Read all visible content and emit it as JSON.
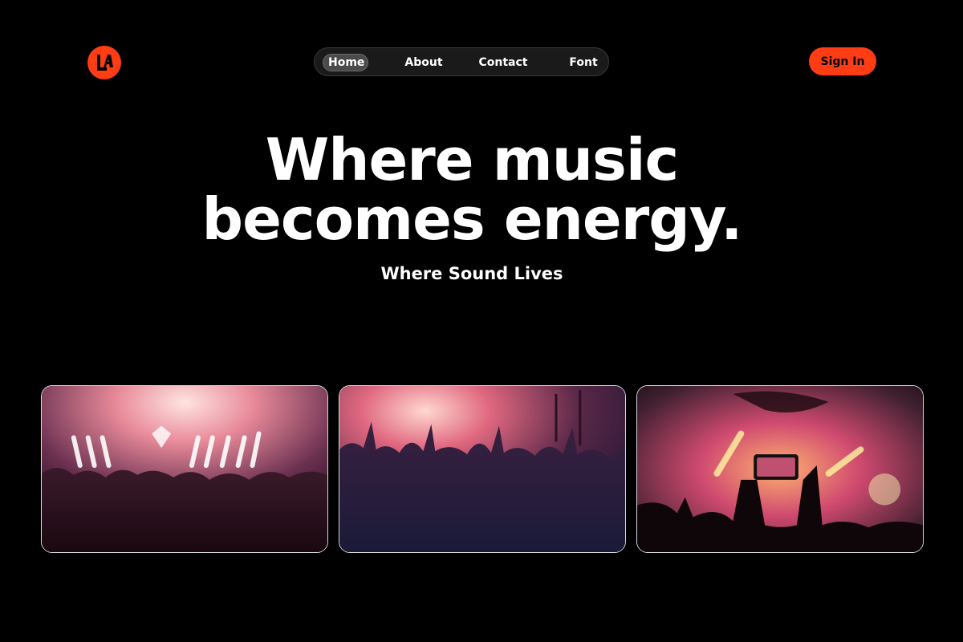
{
  "brand": {
    "logo_text": "LA",
    "accent_color": "#ff3d14"
  },
  "nav": {
    "items": [
      {
        "label": "Home",
        "active": true
      },
      {
        "label": "About",
        "active": false
      },
      {
        "label": "Contact",
        "active": false
      },
      {
        "label": "Font",
        "active": false
      }
    ]
  },
  "header": {
    "signin_label": "Sign In"
  },
  "hero": {
    "title_line1": "Where music",
    "title_line2": "becomes energy.",
    "subtitle": "Where Sound Lives"
  },
  "gallery": {
    "photos": [
      {
        "subject": "concert crowd with neon stage lights"
      },
      {
        "subject": "crowd raising hands at festival"
      },
      {
        "subject": "fan filming stage with phone"
      }
    ]
  }
}
